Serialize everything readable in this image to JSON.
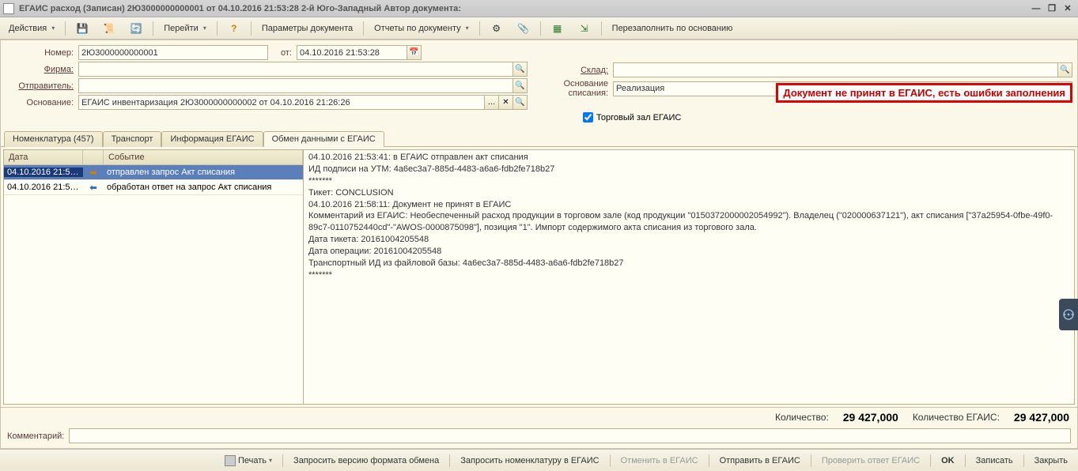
{
  "titlebar": "ЕГАИС расход (Записан)  2Ю3000000000001 от 04.10.2016 21:53:28 2-й Юго-Западный Автор документа:",
  "toolbar": {
    "actions": "Действия",
    "goto": "Перейти",
    "doc_params": "Параметры документа",
    "reports": "Отчеты по документу",
    "refill": "Перезаполнить по основанию"
  },
  "labels": {
    "number": "Номер:",
    "from": "от:",
    "firm": "Фирма:",
    "sender": "Отправитель:",
    "basis": "Основание:",
    "warehouse": "Склад:",
    "writeoff_basis": "Основание списания:",
    "trade_hall": "Торговый зал ЕГАИС",
    "comment": "Комментарий:"
  },
  "fields": {
    "number": "2Ю3000000000001",
    "date": "04.10.2016 21:53:28",
    "firm": "",
    "sender": "",
    "basis": "ЕГАИС инвентаризация 2Ю3000000000002 от 04.10.2016 21:26:26",
    "warehouse": "",
    "writeoff_basis": "Реализация",
    "trade_hall_checked": true,
    "comment": ""
  },
  "error_banner": "Документ не принят в ЕГАИС, есть ошибки заполнения",
  "tabs": [
    "Номенклатура (457)",
    "Транспорт",
    "Информация ЕГАИС",
    "Обмен данными с ЕГАИС"
  ],
  "active_tab": 3,
  "grid": {
    "headers": {
      "date": "Дата",
      "event": "Событие"
    },
    "rows": [
      {
        "date": "04.10.2016 21:53…",
        "dir": "out",
        "event": "отправлен запрос Акт списания",
        "selected": true
      },
      {
        "date": "04.10.2016 21:58…",
        "dir": "in",
        "event": "обработан ответ на запрос Акт списания",
        "selected": false
      }
    ]
  },
  "detail": "04.10.2016 21:53:41: в ЕГАИС отправлен акт списания\nИД подписи на УТМ: 4a6ec3a7-885d-4483-a6a6-fdb2fe718b27\n*******\nТикет: CONCLUSION\n04.10.2016 21:58:11: Документ не принят в ЕГАИС\nКомментарий из ЕГАИС: Необеспеченный расход продукции в торговом зале (код продукции \"0150372000002054992\"). Владелец (\"020000637121\"), акт списания [\"37a25954-0fbe-49f0-89c7-0110752440cd\"-\"AWOS-0000875098\"], позиция \"1\". Импорт содержимого акта списания из торгового зала.\nДата тикета: 20161004205548\nДата операции: 20161004205548\nТранспортный ИД из файловой базы: 4a6ec3a7-885d-4483-a6a6-fdb2fe718b27\n*******",
  "totals": {
    "qty_label": "Количество:",
    "qty": "29 427,000",
    "qty_egais_label": "Количество ЕГАИС:",
    "qty_egais": "29 427,000"
  },
  "bottom": {
    "print": "Печать",
    "req_ver": "Запросить версию формата обмена",
    "req_nom": "Запросить номенклатуру в ЕГАИС",
    "cancel": "Отменить в ЕГАИС",
    "send": "Отправить в ЕГАИС",
    "check": "Проверить ответ ЕГАИС",
    "ok": "OK",
    "save": "Записать",
    "close": "Закрыть"
  }
}
